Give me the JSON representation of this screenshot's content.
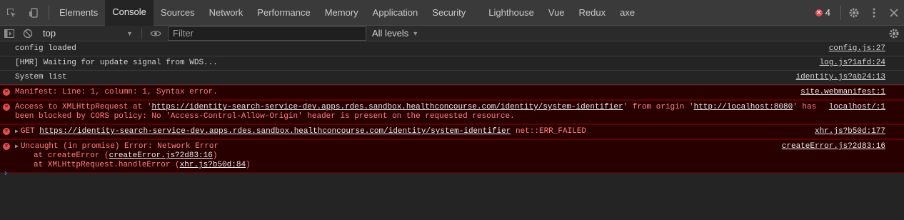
{
  "tabs": [
    "Elements",
    "Console",
    "Sources",
    "Network",
    "Performance",
    "Memory",
    "Application",
    "Security",
    "Lighthouse",
    "Vue",
    "Redux",
    "axe"
  ],
  "error_count": "4",
  "toolbar": {
    "context": "top",
    "filter_placeholder": "Filter",
    "levels": "All levels"
  },
  "messages": {
    "m1": {
      "text": "config loaded",
      "source": "config.js:27"
    },
    "m2": {
      "text": "[HMR] Waiting for update signal from WDS...",
      "source": "log.js?1afd:24"
    },
    "m3": {
      "text": "System list",
      "source": "identity.js?ab24:13"
    },
    "e1": {
      "text": "Manifest: Line: 1, column: 1, Syntax error.",
      "source": "site.webmanifest:1"
    },
    "e2": {
      "prefix": "Access to XMLHttpRequest at '",
      "url": "https://identity-search-service-dev.apps.rdes.sandbox.healthconcourse.com/identity/system-identifier",
      "mid": "' from origin '",
      "origin": "http://localhost:8080",
      "suffix": "' has been blocked by CORS policy: No 'Access-Control-Allow-Origin' header is present on the requested resource.",
      "source": "localhost/:1"
    },
    "e3": {
      "method": "GET",
      "url": "https://identity-search-service-dev.apps.rdes.sandbox.healthconcourse.com/identity/system-identifier",
      "status": "net::ERR_FAILED",
      "source": "xhr.js?b50d:177"
    },
    "e4": {
      "line1": "Uncaught (in promise) Error: Network Error",
      "line2_prefix": "at createError (",
      "line2_link": "createError.js?2d83:16",
      "line3_prefix": "at XMLHttpRequest.handleError (",
      "line3_link": "xhr.js?b50d:84",
      "source": "createError.js?2d83:16"
    }
  },
  "prompt_symbol": "›"
}
